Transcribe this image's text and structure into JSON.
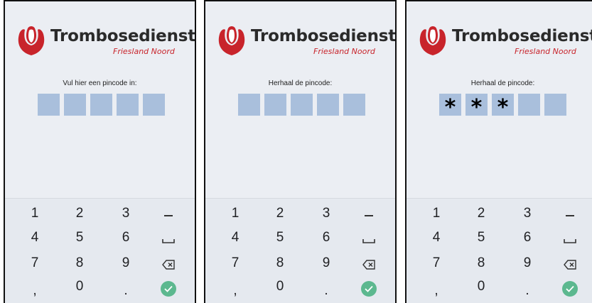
{
  "screens": [
    {
      "brand": "Trombosedienst",
      "brand_sub": "Friesland Noord",
      "prompt": "Vul hier een pincode in:",
      "pin": [
        "",
        "",
        "",
        "",
        ""
      ],
      "keys": [
        "1",
        "2",
        "3",
        "4",
        "5",
        "6",
        "7",
        "8",
        "9",
        ",",
        "0",
        "."
      ]
    },
    {
      "brand": "Trombosedienst",
      "brand_sub": "Friesland Noord",
      "prompt": "Herhaal de pincode:",
      "pin": [
        "",
        "",
        "",
        "",
        ""
      ],
      "keys": [
        "1",
        "2",
        "3",
        "4",
        "5",
        "6",
        "7",
        "8",
        "9",
        ",",
        "0",
        "."
      ]
    },
    {
      "brand": "Trombosedienst",
      "brand_sub": "Friesland Noord",
      "prompt": "Herhaal de pincode:",
      "pin": [
        "*",
        "*",
        "*",
        "",
        ""
      ],
      "keys": [
        "1",
        "2",
        "3",
        "4",
        "5",
        "6",
        "7",
        "8",
        "9",
        ",",
        "0",
        "."
      ]
    }
  ],
  "keypad_icons": [
    "minus-icon",
    "space-icon",
    "backspace-icon",
    "check-icon"
  ],
  "colors": {
    "brand_red": "#c8242b",
    "pin_box": "#a9bfdc",
    "check_green": "#5cb88f",
    "screen_bg": "#ebeef3"
  }
}
